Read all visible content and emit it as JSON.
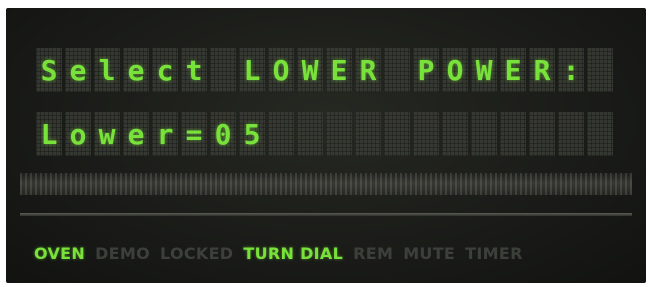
{
  "display": {
    "line1": "Select LOWER POWER:",
    "line2": "Lower=05",
    "columns": 20,
    "text_color": "#79e23a",
    "unlit_color": "#3d403a",
    "background": "#1a1b18"
  },
  "status_indicators": [
    {
      "label": "OVEN",
      "lit": true
    },
    {
      "label": "DEMO",
      "lit": false
    },
    {
      "label": "LOCKED",
      "lit": false
    },
    {
      "label": "TURN DIAL",
      "lit": true
    },
    {
      "label": "REM",
      "lit": false
    },
    {
      "label": "MUTE",
      "lit": false
    },
    {
      "label": "TIMER",
      "lit": false
    }
  ]
}
